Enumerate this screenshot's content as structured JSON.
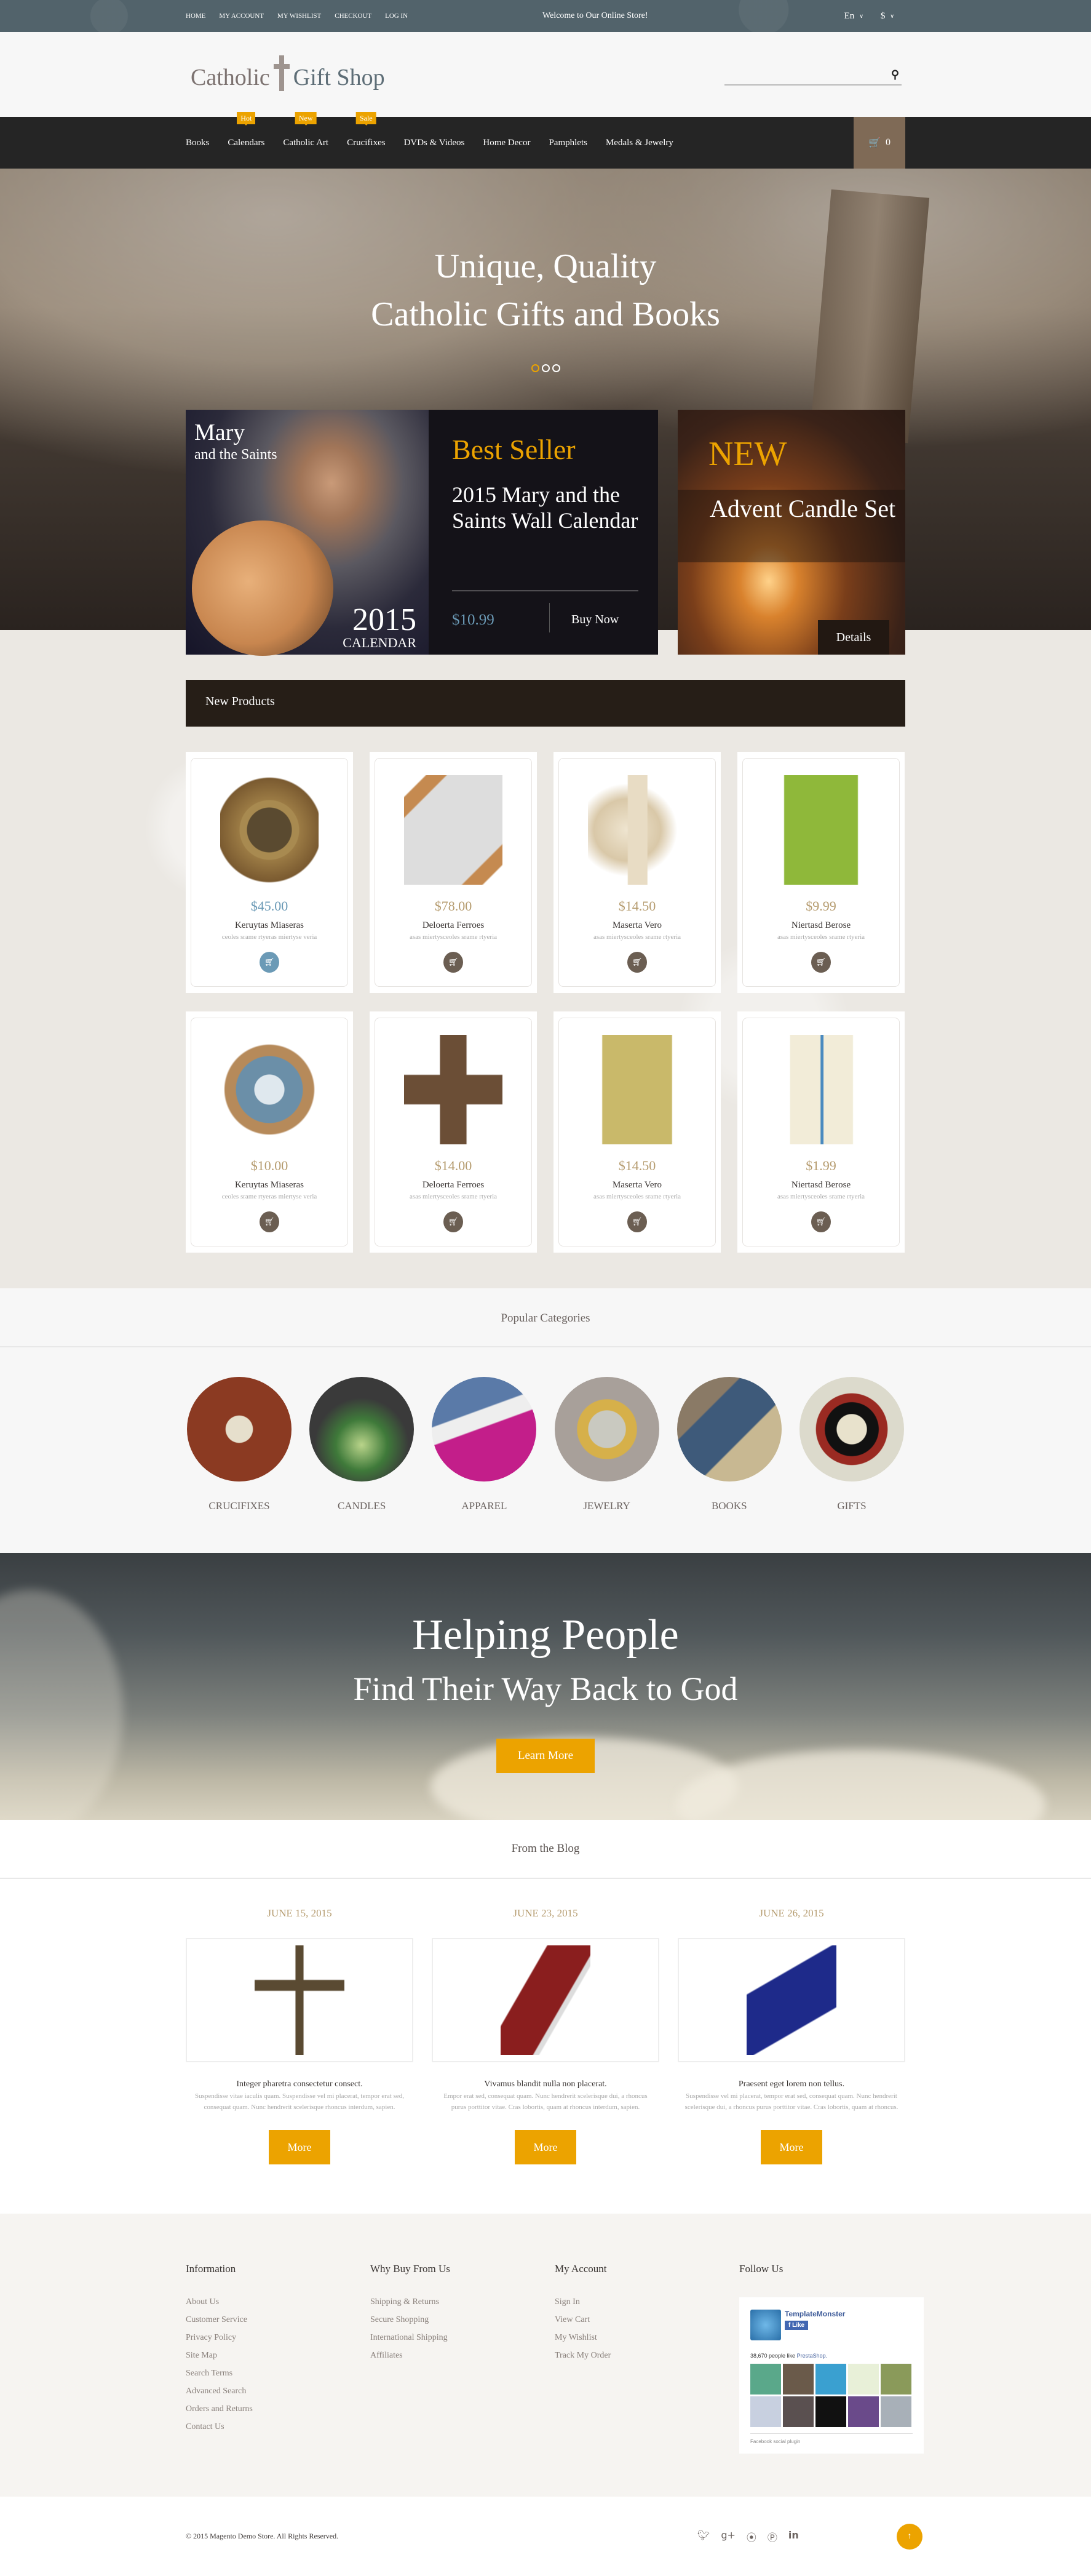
{
  "topbar": {
    "links": [
      "HOME",
      "MY ACCOUNT",
      "MY WISHLIST",
      "CHECKOUT",
      "LOG IN"
    ],
    "welcome": "Welcome to Our Online Store!",
    "language": "En",
    "currency": "$"
  },
  "header": {
    "logo_left": "Catholic",
    "logo_right": "Gift Shop",
    "search_placeholder": "",
    "search_icon": "search-icon"
  },
  "nav": {
    "items": [
      {
        "label": "Books",
        "badge": null
      },
      {
        "label": "Calendars",
        "badge": "Hot"
      },
      {
        "label": "Catholic Art",
        "badge": "New"
      },
      {
        "label": "Crucifixes",
        "badge": "Sale"
      },
      {
        "label": "DVDs & Videos",
        "badge": null
      },
      {
        "label": "Home Decor",
        "badge": null
      },
      {
        "label": "Pamphlets",
        "badge": null
      },
      {
        "label": "Medals & Jewelry",
        "badge": null
      }
    ],
    "cart_count": "0",
    "cart_icon": "shopping-cart-icon"
  },
  "hero": {
    "line1": "Unique, Quality",
    "line2": "Catholic Gifts and Books",
    "slides": 3,
    "active_slide": 1
  },
  "promo": {
    "bestseller": {
      "cover_title1": "Mary",
      "cover_title2": "and the Saints",
      "cover_year": "2015",
      "cover_calendar": "CALENDAR",
      "label": "Best Seller",
      "title": "2015 Mary and the Saints Wall Calendar",
      "price": "$10.99",
      "button": "Buy Now"
    },
    "new": {
      "label": "NEW",
      "title": "Advent Candle Set",
      "button": "Details"
    }
  },
  "new_products": {
    "title": "New Products",
    "items": [
      {
        "price": "$45.00",
        "name": "Keruytas Miaseras",
        "desc": "ceoles srame rtyeras miertyse veria",
        "highlight": true
      },
      {
        "price": "$78.00",
        "name": "Deloerta Ferroes",
        "desc": "asas miertysceoles srame rtyeria"
      },
      {
        "price": "$14.50",
        "name": "Maserta Vero",
        "desc": "asas miertysceoles srame rtyeria"
      },
      {
        "price": "$9.99",
        "name": "Niertasd Berose",
        "desc": "asas miertysceoles srame rtyeria"
      },
      {
        "price": "$10.00",
        "name": "Keruytas Miaseras",
        "desc": "ceoles srame rtyeras miertyse veria"
      },
      {
        "price": "$14.00",
        "name": "Deloerta Ferroes",
        "desc": "asas miertysceoles srame rtyeria"
      },
      {
        "price": "$14.50",
        "name": "Maserta Vero",
        "desc": "asas miertysceoles srame rtyeria"
      },
      {
        "price": "$1.99",
        "name": "Niertasd Berose",
        "desc": "asas miertysceoles srame rtyeria"
      }
    ]
  },
  "categories": {
    "title": "Popular Categories",
    "items": [
      "CRUCIFIXES",
      "CANDLES",
      "APPAREL",
      "JEWELRY",
      "BOOKS",
      "GIFTS"
    ]
  },
  "banner": {
    "line1": "Helping People",
    "line2": "Find Their Way Back to God",
    "button": "Learn More"
  },
  "blog": {
    "title": "From the Blog",
    "posts": [
      {
        "date": "JUNE 15, 2015",
        "title": "Integer pharetra consectetur consect.",
        "text": "Suspendisse vitae iaculis quam. Suspendisse vel mi placerat, tempor erat sed, consequat quam. Nunc hendrerit scelerisque rhoncus interdum, sapien.",
        "button": "More"
      },
      {
        "date": "JUNE 23, 2015",
        "title": "Vivamus blandit nulla non placerat.",
        "text": "Empor erat sed, consequat quam. Nunc hendrerit scelerisque dui, a rhoncus purus porttitor vitae. Cras lobortis, quam at rhoncus interdum, sapien.",
        "button": "More"
      },
      {
        "date": "JUNE 26, 2015",
        "title": "Praesent eget lorem non tellus.",
        "text": "Suspendisse vel mi placerat, tempor erat sed, consequat quam. Nunc hendrerit scelerisque dui, a rhoncus purus porttitor vitae. Cras lobortis, quam at rhoncus.",
        "button": "More"
      }
    ]
  },
  "footer": {
    "columns": [
      {
        "title": "Information",
        "links": [
          "About Us",
          "Customer Service",
          "Privacy Policy",
          "Site Map",
          "Search Terms",
          "Advanced Search",
          "Orders and Returns",
          "Contact Us"
        ]
      },
      {
        "title": "Why Buy From Us",
        "links": [
          "Shipping & Returns",
          "Secure Shopping",
          "International Shipping",
          "Affiliates"
        ]
      },
      {
        "title": "My Account",
        "links": [
          "Sign In",
          "View Cart",
          "My Wishlist",
          "Track My Order"
        ]
      }
    ],
    "follow_title": "Follow Us",
    "facebook": {
      "page_name": "TemplateMonster",
      "like_label": "Like",
      "count_text": "38,670 people like",
      "count_link": "PrestaShop.",
      "plugin_label": "Facebook social plugin"
    },
    "copyright": "© 2015 Magento Demo Store. All Rights Reserved.",
    "social": [
      "twitter-icon",
      "google-plus-icon",
      "rss-icon",
      "pinterest-icon",
      "linkedin-icon"
    ],
    "back_to_top": "↑"
  },
  "colors": {
    "accent": "#eca300",
    "topbar": "#52636b",
    "nav": "#252525",
    "cart_bg": "#7f6a56",
    "price_blue": "#6b9ab6",
    "price_gold": "#b59b6e"
  }
}
